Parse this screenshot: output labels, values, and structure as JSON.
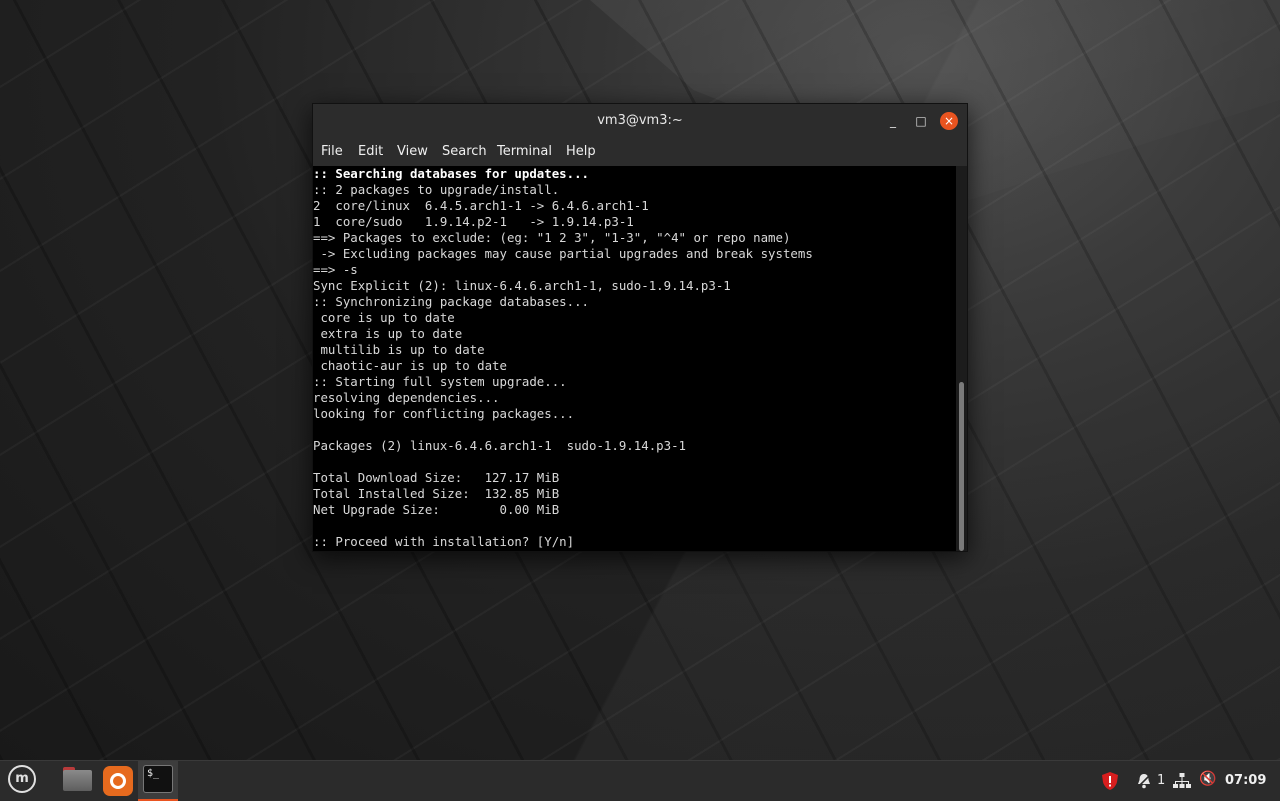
{
  "window": {
    "title": "vm3@vm3:~",
    "controls": {
      "minimize": "_",
      "maximize": "□",
      "close": "×"
    },
    "menu": [
      "File",
      "Edit",
      "View",
      "Search",
      "Terminal",
      "Help"
    ]
  },
  "terminal": {
    "lines": [
      {
        "text": ":: Searching databases for updates...",
        "bold": true
      },
      {
        "text": ":: 2 packages to upgrade/install."
      },
      {
        "text": "2  core/linux  6.4.5.arch1-1 -> 6.4.6.arch1-1"
      },
      {
        "text": "1  core/sudo   1.9.14.p2-1   -> 1.9.14.p3-1"
      },
      {
        "text": "==> Packages to exclude: (eg: \"1 2 3\", \"1-3\", \"^4\" or repo name)"
      },
      {
        "text": " -> Excluding packages may cause partial upgrades and break systems"
      },
      {
        "text": "==> -s"
      },
      {
        "text": "Sync Explicit (2): linux-6.4.6.arch1-1, sudo-1.9.14.p3-1"
      },
      {
        "text": ":: Synchronizing package databases..."
      },
      {
        "text": " core is up to date"
      },
      {
        "text": " extra is up to date"
      },
      {
        "text": " multilib is up to date"
      },
      {
        "text": " chaotic-aur is up to date"
      },
      {
        "text": ":: Starting full system upgrade..."
      },
      {
        "text": "resolving dependencies..."
      },
      {
        "text": "looking for conflicting packages..."
      },
      {
        "text": ""
      },
      {
        "text": "Packages (2) linux-6.4.6.arch1-1  sudo-1.9.14.p3-1"
      },
      {
        "text": ""
      },
      {
        "text": "Total Download Size:   127.17 MiB"
      },
      {
        "text": "Total Installed Size:  132.85 MiB"
      },
      {
        "text": "Net Upgrade Size:        0.00 MiB"
      },
      {
        "text": ""
      },
      {
        "text": ":: Proceed with installation? [Y/n]"
      }
    ],
    "scroll_position": 0.56,
    "scroll_visible_fraction": 0.44
  },
  "taskbar": {
    "menu_glyph": "m",
    "terminal_glyph": "$_",
    "tray": {
      "notification_count": "1",
      "volume_glyph": "🔇",
      "clock": "07:09"
    }
  },
  "colors": {
    "accent": "#e95420",
    "shield": "#d81e1e",
    "titlebar": "#2c2c2c",
    "taskbar": "#2b2b2b"
  },
  "icons": [
    "mint-menu-icon",
    "folder-icon",
    "firefox-icon",
    "terminal-icon",
    "shield-icon",
    "notification-bell-icon",
    "network-icon",
    "volume-muted-icon"
  ]
}
